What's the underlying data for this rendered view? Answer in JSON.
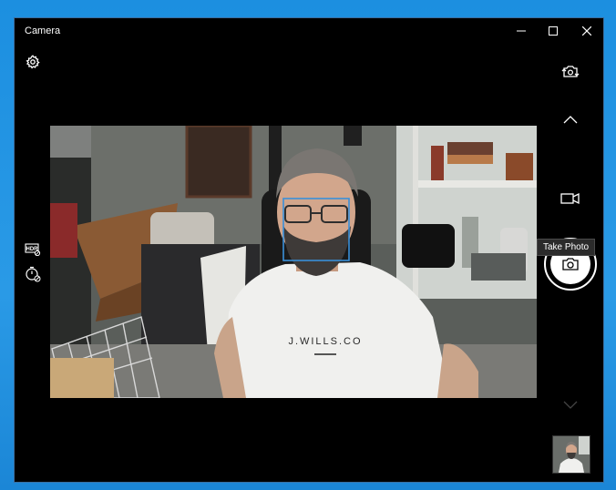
{
  "window": {
    "title": "Camera",
    "minimize_icon": "minimize-icon",
    "maximize_icon": "maximize-icon",
    "close_icon": "close-icon"
  },
  "toolbar": {
    "settings_icon": "gear-icon",
    "switch_camera_icon": "switch-camera-icon",
    "hdr_icon": "hdr-icon",
    "timer_icon": "timer-icon"
  },
  "modes": {
    "up_icon": "chevron-up-icon",
    "video_icon": "video-camera-icon",
    "photo_icon": "camera-icon",
    "down_icon": "chevron-down-icon"
  },
  "capture": {
    "tooltip": "Take Photo"
  },
  "preview": {
    "shirt_text": "J.WILLS.CO",
    "face_box_color": "#3a8fd9"
  },
  "colors": {
    "accent": "#1e90dd",
    "window_bg": "#000000",
    "icon": "#ffffff"
  }
}
